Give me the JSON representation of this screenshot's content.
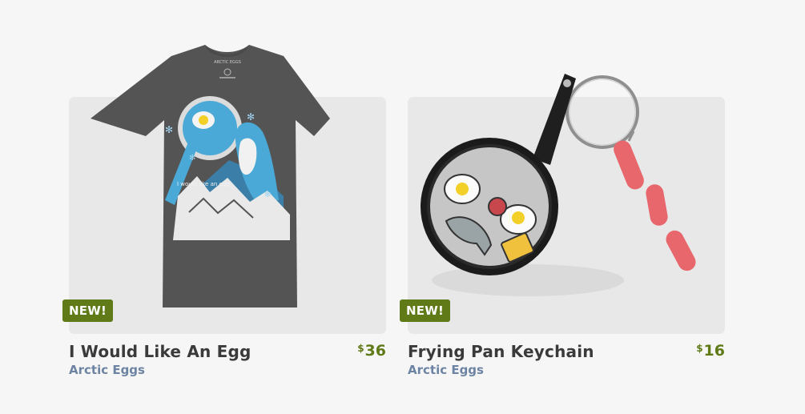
{
  "products": [
    {
      "badge": "NEW!",
      "title": "I Would Like An Egg",
      "brand": "Arctic Eggs",
      "currency": "$",
      "price": "36",
      "print_text": "I would like an egg",
      "tag_text": "ARCTIC EGGS"
    },
    {
      "badge": "NEW!",
      "title": "Frying Pan Keychain",
      "brand": "Arctic Eggs",
      "currency": "$",
      "price": "16"
    }
  ],
  "colors": {
    "background": "#f6f6f6",
    "tile": "#e8e8e8",
    "badge": "#5f7a17",
    "price": "#5f7a17",
    "brand": "#6d83a3",
    "shirt": "#545454",
    "print_blue": "#4aa9d6"
  }
}
